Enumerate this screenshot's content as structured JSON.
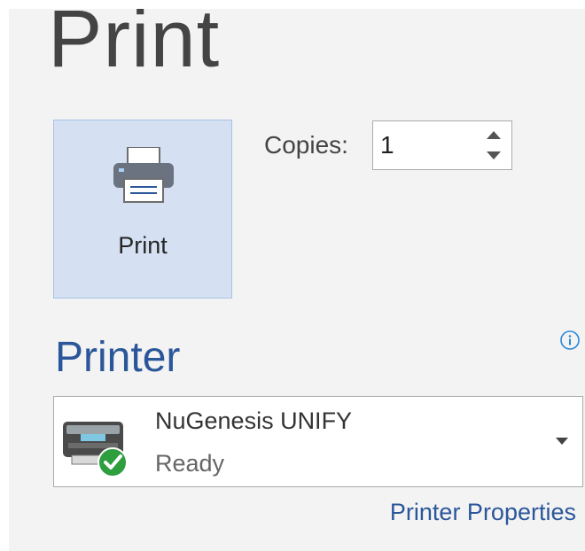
{
  "page": {
    "title": "Print"
  },
  "print_button": {
    "label": "Print",
    "icon": "printer-icon"
  },
  "copies": {
    "label": "Copies:",
    "value": "1"
  },
  "printer": {
    "section_title": "Printer",
    "name": "NuGenesis UNIFY",
    "status": "Ready",
    "properties_link": "Printer Properties"
  },
  "colors": {
    "accent": "#2b579a",
    "button_bg": "#d5e1f2",
    "button_border": "#a7c2e7",
    "panel_bg": "#f3f3f3",
    "ready_green": "#2e9e3e"
  }
}
